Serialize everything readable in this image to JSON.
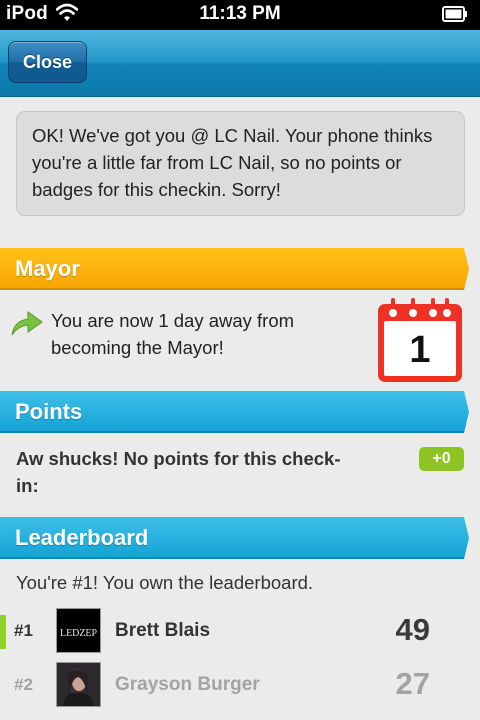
{
  "status_bar": {
    "carrier": "iPod",
    "time": "11:13 PM",
    "wifi_icon": "wifi-icon",
    "battery_icon": "battery-icon"
  },
  "nav": {
    "close_label": "Close"
  },
  "message": {
    "text": "OK! We've got you @ LC Nail. Your phone thinks you're a little far from LC Nail, so no points or badges for this checkin. Sorry!"
  },
  "mayor": {
    "header": "Mayor",
    "text": "You are now 1 day away from becoming the Mayor!",
    "arrow_icon": "green-arrow-icon",
    "calendar_icon": "calendar-icon",
    "calendar_day": "1"
  },
  "points": {
    "header": "Points",
    "text": "Aw shucks! No points for this check-in:",
    "badge": "+0"
  },
  "leaderboard": {
    "header": "Leaderboard",
    "summary": "You're #1! You own the leaderboard.",
    "rows": [
      {
        "rank": "#1",
        "name": "Brett Blais",
        "score": "49",
        "avatar_text": "LEDZEP"
      },
      {
        "rank": "#2",
        "name": "Grayson Burger",
        "score": "27"
      }
    ]
  },
  "colors": {
    "nav_blue": "#1795c9",
    "mayor_orange": "#f8a500",
    "section_blue": "#16a2d5",
    "points_green": "#8cc421",
    "calendar_red": "#ee3124"
  }
}
